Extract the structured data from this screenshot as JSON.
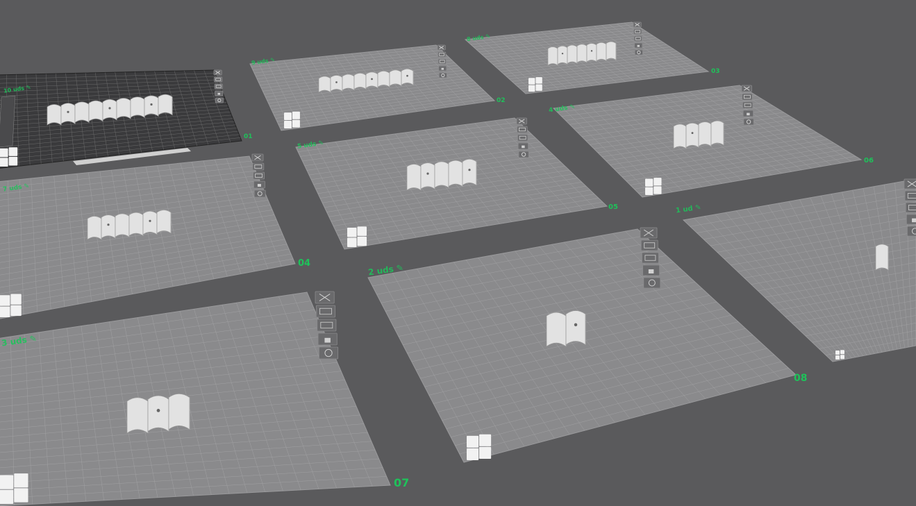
{
  "colors": {
    "background": "#5a5a5c",
    "plate": "#8a8a8c",
    "plate_active": "#3a3a3c",
    "grid": "#b4b4b6",
    "accent_green": "#1ec25a",
    "model": "#e2e2e2",
    "button": "#6a6a6c"
  },
  "plates": [
    {
      "id": "plate-01",
      "number": "01",
      "count_label": "10 uds",
      "active": true,
      "pieces": 9,
      "icons": [
        "close-icon",
        "orient-icon",
        "arrange-icon",
        "lock-icon",
        "settings-icon"
      ]
    },
    {
      "id": "plate-02",
      "number": "02",
      "count_label": "9 uds",
      "active": false,
      "pieces": 8,
      "icons": [
        "close-icon",
        "orient-icon",
        "arrange-icon",
        "lock-icon",
        "settings-icon"
      ]
    },
    {
      "id": "plate-03",
      "number": "03",
      "count_label": "8 uds",
      "active": false,
      "pieces": 7,
      "icons": [
        "close-icon",
        "orient-icon",
        "arrange-icon",
        "lock-icon",
        "settings-icon"
      ]
    },
    {
      "id": "plate-04",
      "number": "04",
      "count_label": "7 uds",
      "active": false,
      "pieces": 6,
      "icons": [
        "close-icon",
        "orient-icon",
        "arrange-icon",
        "lock-icon",
        "settings-icon"
      ]
    },
    {
      "id": "plate-05",
      "number": "05",
      "count_label": "5 uds",
      "active": false,
      "pieces": 5,
      "icons": [
        "close-icon",
        "orient-icon",
        "arrange-icon",
        "lock-icon",
        "settings-icon"
      ]
    },
    {
      "id": "plate-06",
      "number": "06",
      "count_label": "4 uds",
      "active": false,
      "pieces": 4,
      "icons": [
        "close-icon",
        "orient-icon",
        "arrange-icon",
        "lock-icon",
        "settings-icon"
      ]
    },
    {
      "id": "plate-07",
      "number": "07",
      "count_label": "3 uds",
      "active": false,
      "pieces": 3,
      "icons": [
        "close-icon",
        "orient-icon",
        "arrange-icon",
        "lock-icon",
        "settings-icon"
      ]
    },
    {
      "id": "plate-08",
      "number": "08",
      "count_label": "2 uds",
      "active": false,
      "pieces": 2,
      "icons": [
        "close-icon",
        "orient-icon",
        "arrange-icon",
        "lock-icon",
        "settings-icon"
      ]
    },
    {
      "id": "plate-09",
      "number": "",
      "count_label": "1 ud",
      "active": false,
      "pieces": 1,
      "icons": [
        "close-icon",
        "orient-icon",
        "arrange-icon",
        "lock-icon",
        "settings-icon"
      ]
    }
  ]
}
